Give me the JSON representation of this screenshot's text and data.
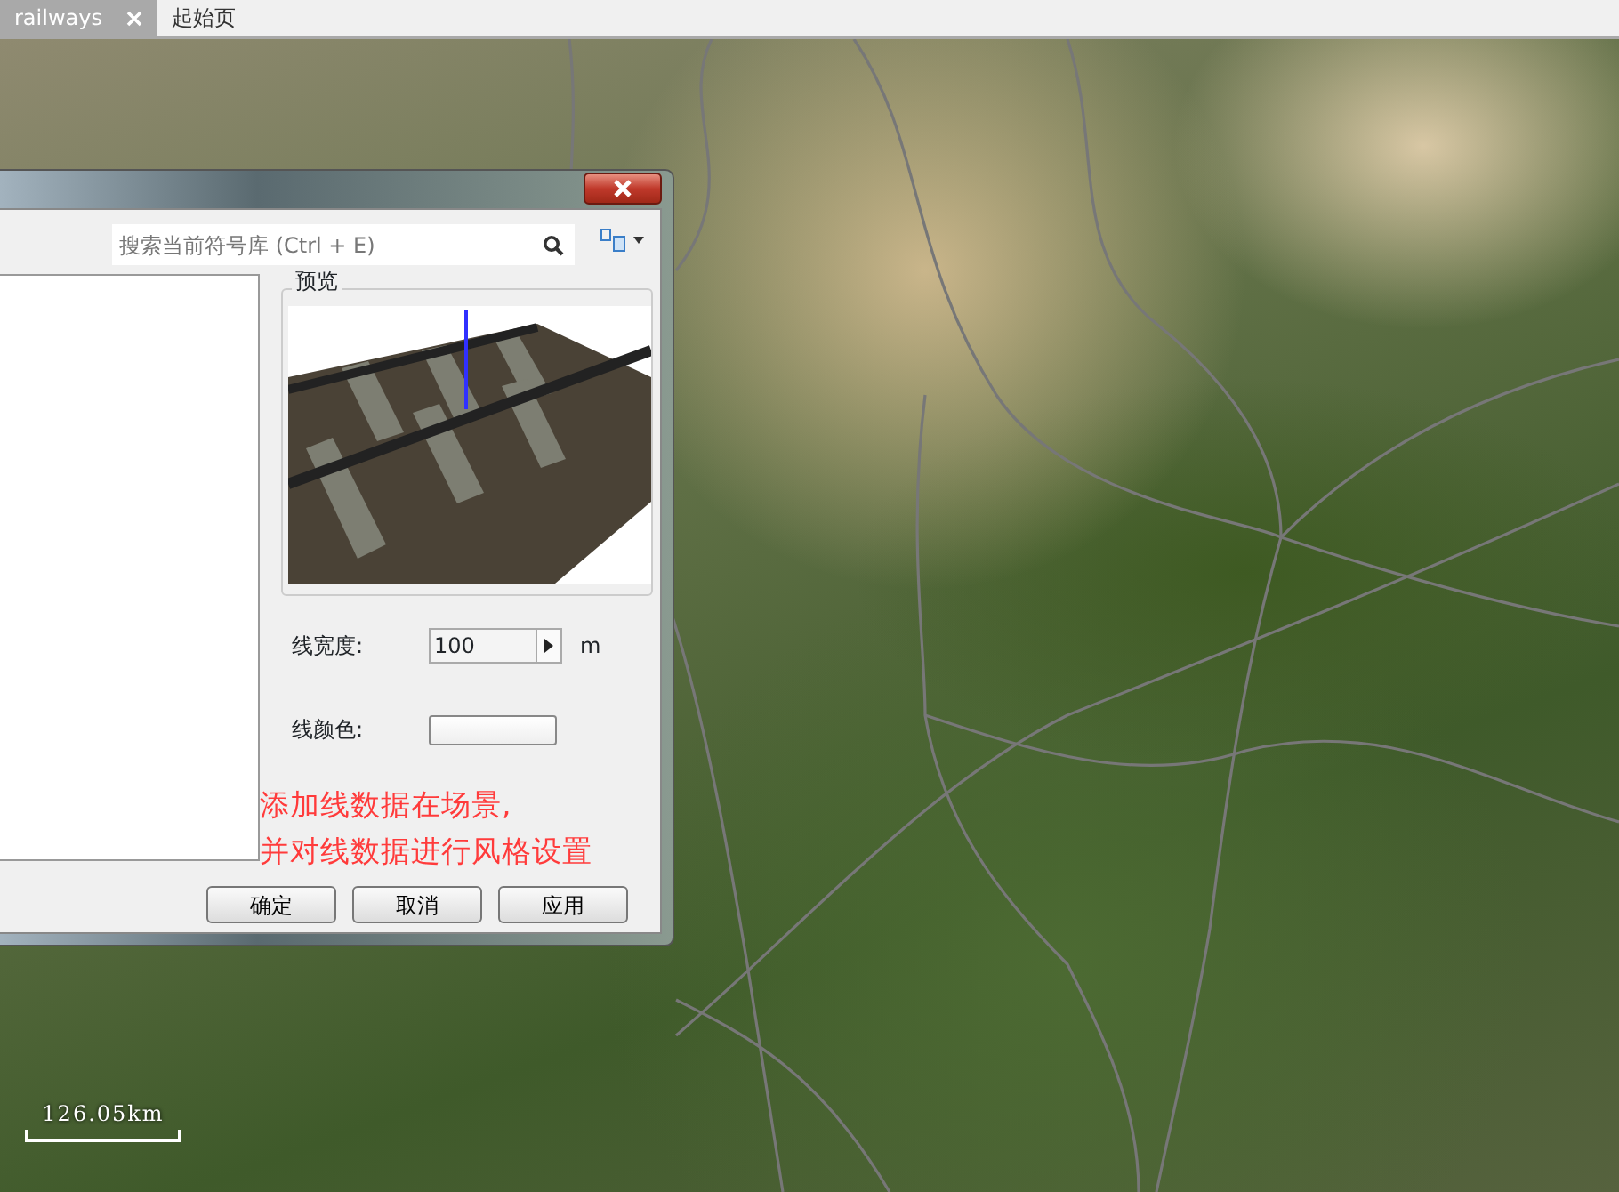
{
  "tabs": [
    {
      "label": "railways",
      "selected": true,
      "closable": true
    },
    {
      "label": "起始页",
      "selected": false,
      "closable": false
    }
  ],
  "dialog": {
    "search": {
      "placeholder": "搜索当前符号库 (Ctrl + E)"
    },
    "preview": {
      "label": "预览"
    },
    "fields": [
      {
        "kind": "spinner",
        "label": "线宽度:",
        "value": "100",
        "unit": "m"
      },
      {
        "kind": "color",
        "label": "线颜色:"
      }
    ],
    "annotation": [
      "添加线数据在场景,",
      "并对线数据进行风格设置"
    ],
    "buttons": [
      "确定",
      "取消",
      "应用"
    ]
  },
  "scale_bar": {
    "label": "126.05km"
  }
}
